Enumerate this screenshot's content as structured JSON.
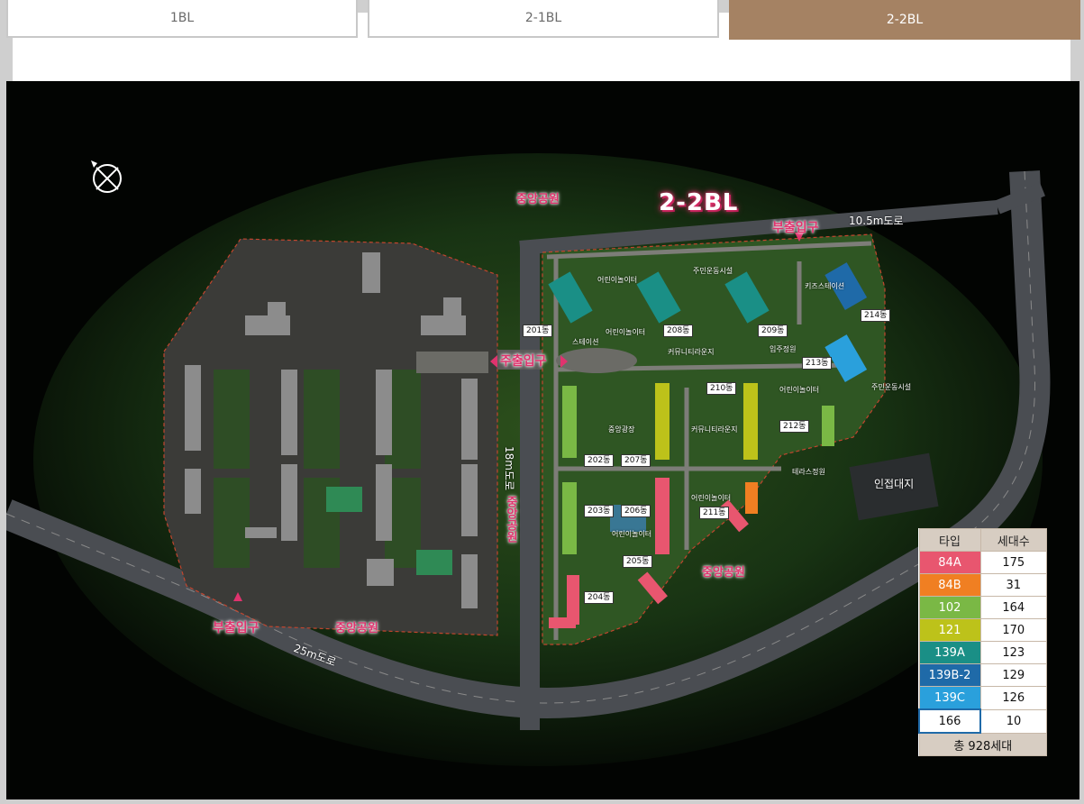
{
  "tabs": [
    {
      "label": "1BL",
      "active": false
    },
    {
      "label": "2-1BL",
      "active": false
    },
    {
      "label": "2-2BL",
      "active": true
    }
  ],
  "colors": {
    "tab_active": "#a58263",
    "label_pink": "#e0336e",
    "legend_header": "#d7cdc2"
  },
  "map": {
    "block_title": "2-2BL",
    "compass_icon": "compass-icon",
    "labels": {
      "central_park_top": "중앙공원",
      "central_park_vertical": "중앙공원",
      "central_park_right": "중앙공원",
      "central_park_bottom": "중앙공원",
      "main_entrance": "주출입구",
      "sub_entrance_top": "부출입구",
      "sub_entrance_left": "부출입구",
      "road_10_5m": "10.5m도로",
      "road_18m": "18m도로",
      "road_25m": "25m도로",
      "adjacent_land": "인접대지"
    },
    "dong_labels": [
      "201동",
      "202동",
      "203동",
      "204동",
      "205동",
      "206동",
      "207동",
      "208동",
      "209동",
      "210동",
      "211동",
      "212동",
      "213동",
      "214동"
    ],
    "facility_labels": [
      "어린이놀이터",
      "주민운동시설",
      "키즈스테이션",
      "주민운동시설",
      "입주정원",
      "커뮤니티라운지",
      "어린이놀이터",
      "스테이션",
      "중앙광장",
      "커뮤니티라운지",
      "어린이놀이터",
      "어린이놀이터",
      "어린이놀이터",
      "테라스정원"
    ]
  },
  "legend": {
    "header_type": "타입",
    "header_count": "세대수",
    "rows": [
      {
        "type": "84A",
        "count": "175",
        "color": "#e8566f"
      },
      {
        "type": "84B",
        "count": "31",
        "color": "#f07f22"
      },
      {
        "type": "102",
        "count": "164",
        "color": "#7ab845"
      },
      {
        "type": "121",
        "count": "170",
        "color": "#bdc21a"
      },
      {
        "type": "139A",
        "count": "123",
        "color": "#1a8f86"
      },
      {
        "type": "139B-2",
        "count": "129",
        "color": "#1f6aa8"
      },
      {
        "type": "139C",
        "count": "126",
        "color": "#2aa0dc"
      },
      {
        "type": "166",
        "count": "10",
        "color": "#ffffff"
      }
    ],
    "total": "총 928세대"
  }
}
